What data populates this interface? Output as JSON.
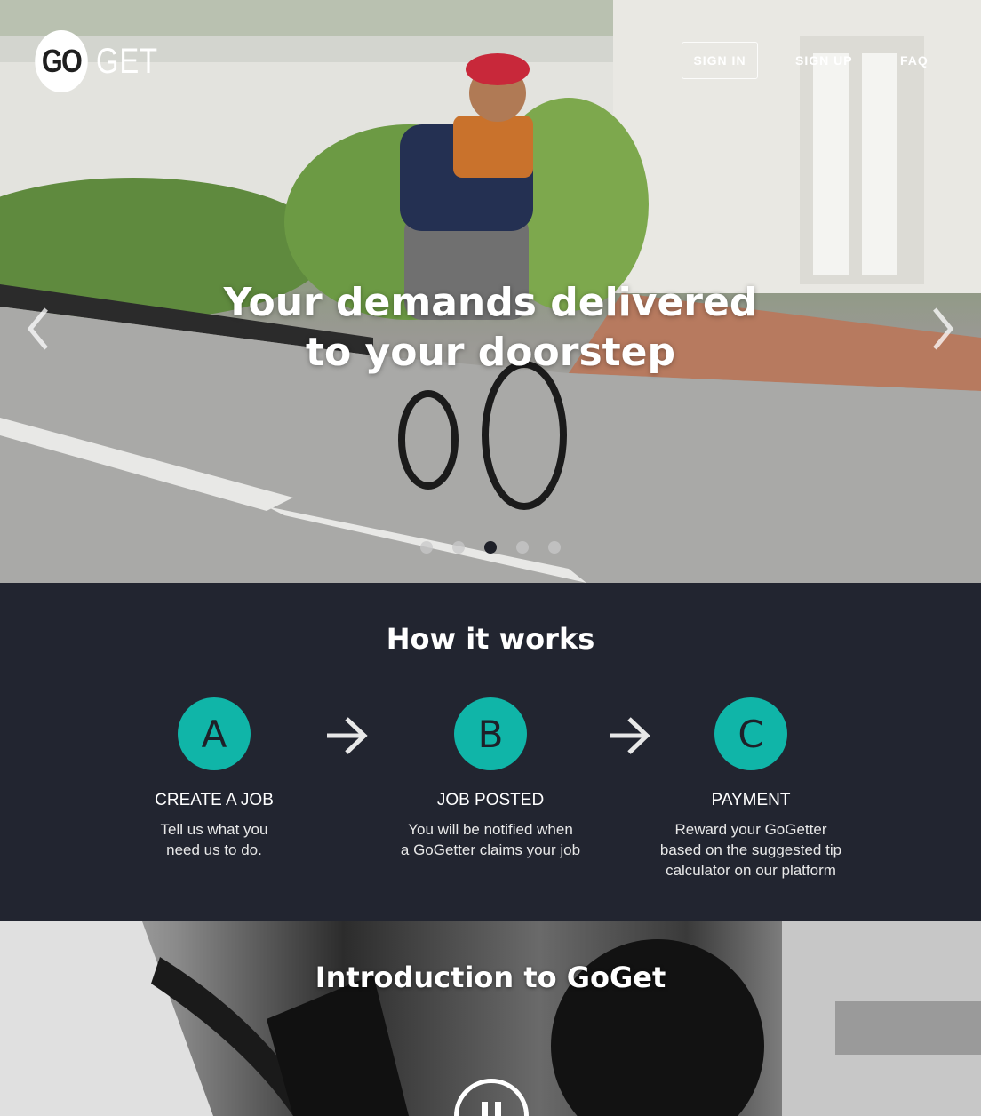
{
  "header": {
    "logo_circle_text": "GO",
    "logo_text": "GET",
    "nav": {
      "sign_in": "SIGN IN",
      "sign_up": "SIGN UP",
      "faq": "FAQ"
    }
  },
  "hero": {
    "headline_line1": "Your demands delivered",
    "headline_line2": "to your doorstep",
    "carousel": {
      "slide_count": 5,
      "active_slide": 3
    }
  },
  "how_it_works": {
    "title": "How it works",
    "steps": [
      {
        "letter": "A",
        "title": "CREATE A JOB",
        "description": "Tell us what you\nneed us to do."
      },
      {
        "letter": "B",
        "title": "JOB POSTED",
        "description": "You will be notified when\na GoGetter claims your job"
      },
      {
        "letter": "C",
        "title": "PAYMENT",
        "description": "Reward your GoGetter\nbased on the suggested tip\ncalculator on our platform"
      }
    ],
    "accent_color": "#10b5a8",
    "background_color": "#222530"
  },
  "intro": {
    "title": "Introduction to GoGet"
  }
}
